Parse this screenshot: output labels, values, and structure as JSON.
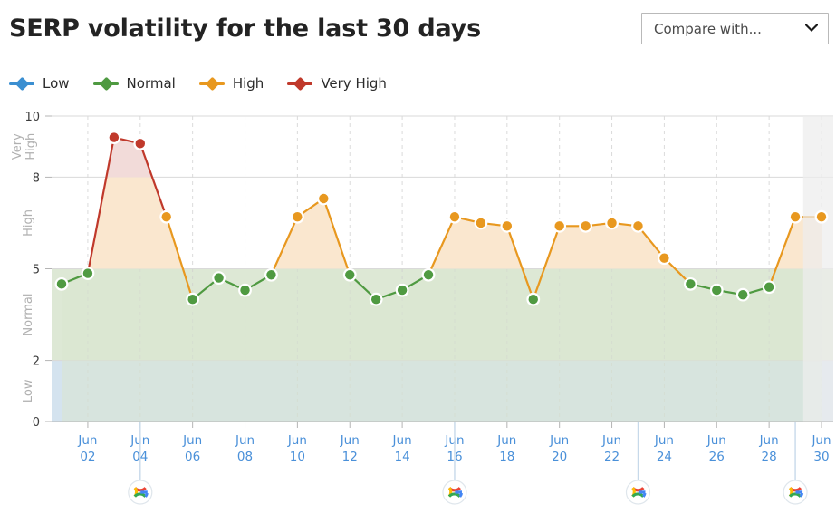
{
  "header": {
    "title": "SERP volatility for the last 30 days",
    "compare_label": "Compare with...",
    "chevron_icon": "chevron-down-icon"
  },
  "legend": {
    "items": [
      {
        "label": "Low",
        "color": "#3b8fd1"
      },
      {
        "label": "Normal",
        "color": "#4f9a41"
      },
      {
        "label": "High",
        "color": "#e8981f"
      },
      {
        "label": "Very High",
        "color": "#c0392b"
      }
    ]
  },
  "chart_data": {
    "type": "line",
    "title": "SERP volatility for the last 30 days",
    "xlabel": "",
    "ylabel": "",
    "ylim": [
      0,
      10
    ],
    "yticks": [
      0,
      2,
      5,
      8,
      10
    ],
    "grid": true,
    "legend_position": "top-left",
    "categories": [
      "Jun 01",
      "Jun 02",
      "Jun 03",
      "Jun 04",
      "Jun 05",
      "Jun 06",
      "Jun 07",
      "Jun 08",
      "Jun 09",
      "Jun 10",
      "Jun 11",
      "Jun 12",
      "Jun 13",
      "Jun 14",
      "Jun 15",
      "Jun 16",
      "Jun 17",
      "Jun 18",
      "Jun 19",
      "Jun 20",
      "Jun 21",
      "Jun 22",
      "Jun 23",
      "Jun 24",
      "Jun 25",
      "Jun 26",
      "Jun 27",
      "Jun 28",
      "Jun 29",
      "Jun 30"
    ],
    "xtick_labels": [
      {
        "top": "Jun",
        "bottom": "02"
      },
      {
        "top": "Jun",
        "bottom": "04"
      },
      {
        "top": "Jun",
        "bottom": "06"
      },
      {
        "top": "Jun",
        "bottom": "08"
      },
      {
        "top": "Jun",
        "bottom": "10"
      },
      {
        "top": "Jun",
        "bottom": "12"
      },
      {
        "top": "Jun",
        "bottom": "14"
      },
      {
        "top": "Jun",
        "bottom": "16"
      },
      {
        "top": "Jun",
        "bottom": "18"
      },
      {
        "top": "Jun",
        "bottom": "20"
      },
      {
        "top": "Jun",
        "bottom": "22"
      },
      {
        "top": "Jun",
        "bottom": "24"
      },
      {
        "top": "Jun",
        "bottom": "26"
      },
      {
        "top": "Jun",
        "bottom": "28"
      },
      {
        "top": "Jun",
        "bottom": "30"
      }
    ],
    "xtick_indices": [
      1,
      3,
      5,
      7,
      9,
      11,
      13,
      15,
      17,
      19,
      21,
      23,
      25,
      27,
      29
    ],
    "values": [
      4.5,
      4.85,
      9.3,
      9.1,
      6.7,
      4.0,
      4.7,
      4.3,
      4.8,
      6.7,
      7.3,
      4.8,
      4.0,
      4.3,
      4.8,
      6.7,
      6.5,
      6.4,
      4.0,
      6.4,
      6.4,
      6.5,
      6.4,
      5.35,
      4.5,
      4.3,
      4.15,
      4.4,
      6.7,
      6.7
    ],
    "point_levels": [
      "normal",
      "normal",
      "veryhigh",
      "veryhigh",
      "high",
      "normal",
      "normal",
      "normal",
      "normal",
      "high",
      "high",
      "normal",
      "normal",
      "normal",
      "normal",
      "high",
      "high",
      "high",
      "normal",
      "high",
      "high",
      "high",
      "high",
      "high",
      "normal",
      "normal",
      "normal",
      "normal",
      "high",
      "high"
    ],
    "bands": [
      {
        "name": "Low",
        "from": 0,
        "to": 2,
        "color": "#d4e3ef"
      },
      {
        "name": "Normal",
        "from": 2,
        "to": 5,
        "color": "#dde8d5"
      },
      {
        "name": "High",
        "from": 5,
        "to": 8,
        "color": "#ffffff"
      },
      {
        "name": "Very High",
        "from": 8,
        "to": 10,
        "color": "#ffffff"
      }
    ],
    "band_labels": [
      "Low",
      "Normal",
      "High",
      "Very High"
    ],
    "series_colors": {
      "low": "#3b8fd1",
      "normal": "#4f9a41",
      "high": "#e8981f",
      "veryhigh": "#c0392b"
    },
    "fill_colors": {
      "high": "#fae7cf",
      "veryhigh": "#f2dbd9"
    },
    "update_markers": {
      "icon": "google-icon",
      "dates": [
        "Jun 04",
        "Jun 16",
        "Jun 23",
        "Jun 29"
      ],
      "indices": [
        3,
        15,
        22,
        28
      ]
    },
    "today_shading": {
      "from_index": 28.3,
      "color": "#ededed"
    }
  }
}
